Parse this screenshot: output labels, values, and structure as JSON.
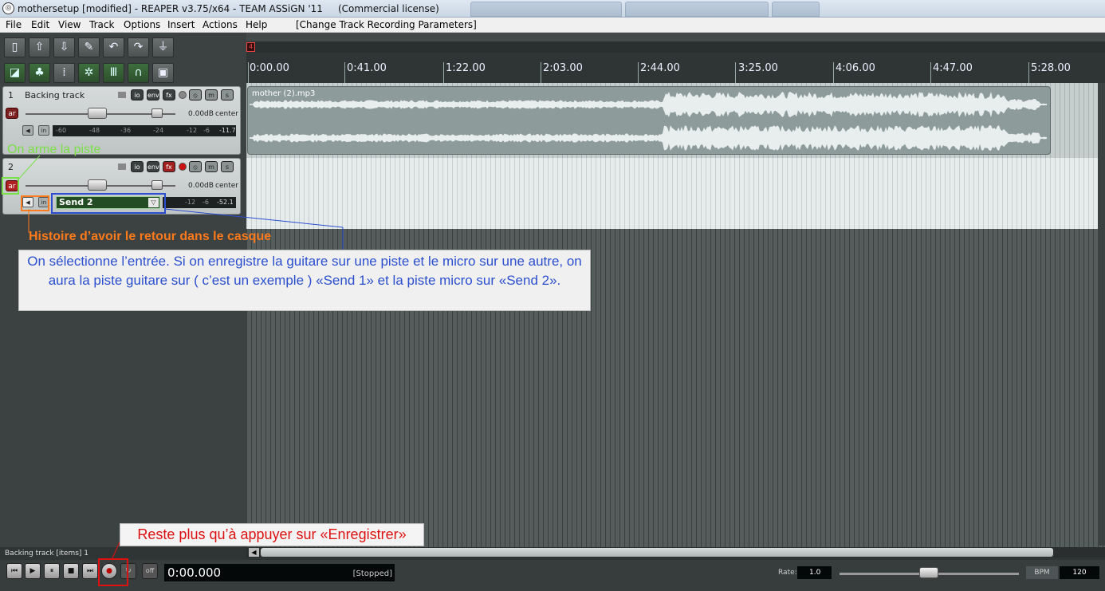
{
  "window": {
    "icon": "reaper-logo-icon",
    "title": "mothersetup [modified] - REAPER v3.75/x64 - TEAM ASSiGN '11     (Commercial license)"
  },
  "menu": {
    "items": [
      "File",
      "Edit",
      "View",
      "Track",
      "Options",
      "Insert",
      "Actions",
      "Help"
    ],
    "action_text": "[Change Track Recording Parameters]"
  },
  "toolbar": {
    "icons": [
      "new-project-icon",
      "open-icon",
      "save-icon",
      "preferences-icon",
      "undo-icon",
      "redo-icon",
      "metronome-icon",
      "snap-icon",
      "ripple-icon",
      "grid-icon",
      "auto-crossfade-icon",
      "envelope-link-icon",
      "loop-icon",
      "lock-icon"
    ]
  },
  "tracks": [
    {
      "number": "1",
      "name": "Backing track",
      "io": "io",
      "env": "env",
      "fx": "fx",
      "vol": "0.00dB",
      "pan": "center",
      "arm": "ar",
      "in": "in",
      "meter_scale": [
        "-60",
        "-48",
        "-36",
        "-24",
        "-12",
        "-6"
      ],
      "meter_peak": "-11.7"
    },
    {
      "number": "2",
      "name": "",
      "io": "io",
      "env": "env",
      "fx": "fx",
      "vol": "0.00dB",
      "pan": "center",
      "arm": "ar",
      "in": "in",
      "input": "Send 2",
      "meter_scale": [
        "-12",
        "-6"
      ],
      "meter_peak": "-52.1"
    }
  ],
  "ruler": {
    "marker": "4",
    "ticks": [
      "0:00.00",
      "0:41.00",
      "1:22.00",
      "2:03.00",
      "2:44.00",
      "3:25.00",
      "4:06.00",
      "4:47.00",
      "5:28.00"
    ]
  },
  "item": {
    "label": "mother (2).mp3"
  },
  "status": {
    "text": "Backing track [items] 1"
  },
  "transport": {
    "time": "0:00.000",
    "state": "[Stopped]",
    "rate_label": "Rate:",
    "rate": "1.0",
    "rate_fraction": 0.5,
    "bpm_label": "BPM",
    "bpm": "120",
    "off": "off"
  },
  "annotations": {
    "green": "On arme la piste",
    "orange": "Histoire d’avoir le retour dans le casque",
    "blue": "On sélectionne l’entrée. Si on enregistre la guitare sur une piste et le micro sur une autre, on aura la piste guitare sur ( c’est un exemple ) «Send 1» et la piste micro sur «Send 2».",
    "red": "Reste plus qu’à appuyer sur «Enregistrer»"
  },
  "colors": {
    "annotation_green": "#7be04a",
    "annotation_orange": "#ff7a1a",
    "annotation_blue": "#2b4fcf",
    "annotation_red": "#dd1111",
    "arm": "#a02020"
  }
}
